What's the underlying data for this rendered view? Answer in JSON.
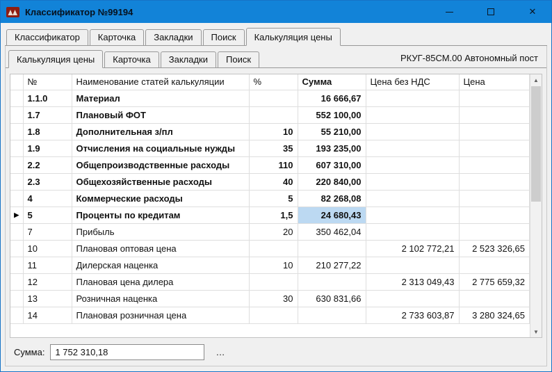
{
  "colors": {
    "titlebar": "#1283d8",
    "selection": "#bcd9f2",
    "window_border": "#1673c6"
  },
  "window": {
    "title": "Классификатор №99194"
  },
  "outer_tabs": [
    {
      "label": "Классификатор"
    },
    {
      "label": "Карточка"
    },
    {
      "label": "Закладки"
    },
    {
      "label": "Поиск"
    },
    {
      "label": "Калькуляция цены"
    }
  ],
  "inner_tabs": [
    {
      "label": "Калькуляция цены"
    },
    {
      "label": "Карточка"
    },
    {
      "label": "Закладки"
    },
    {
      "label": "Поиск"
    }
  ],
  "document_label": "РКУГ-85СМ.00 Автономный пост",
  "table": {
    "columns": [
      "№",
      "Наименование статей калькуляции",
      "%",
      "Сумма",
      "Цена без НДС",
      "Цена"
    ],
    "rows": [
      {
        "num": "1.1.0",
        "name": "Материал",
        "pct": "",
        "sum": "16 666,67",
        "nds": "",
        "price": "",
        "bold": true,
        "selected": false
      },
      {
        "num": "1.7",
        "name": "Плановый ФОТ",
        "pct": "",
        "sum": "552 100,00",
        "nds": "",
        "price": "",
        "bold": true,
        "selected": false
      },
      {
        "num": "1.8",
        "name": "Дополнительная з/пл",
        "pct": "10",
        "sum": "55 210,00",
        "nds": "",
        "price": "",
        "bold": true,
        "selected": false
      },
      {
        "num": "1.9",
        "name": "Отчисления на социальные нужды",
        "pct": "35",
        "sum": "193 235,00",
        "nds": "",
        "price": "",
        "bold": true,
        "selected": false
      },
      {
        "num": "2.2",
        "name": "Общепроизводственные расходы",
        "pct": "110",
        "sum": "607 310,00",
        "nds": "",
        "price": "",
        "bold": true,
        "selected": false
      },
      {
        "num": "2.3",
        "name": "Общехозяйственные расходы",
        "pct": "40",
        "sum": "220 840,00",
        "nds": "",
        "price": "",
        "bold": true,
        "selected": false
      },
      {
        "num": "4",
        "name": "Коммерческие расходы",
        "pct": "5",
        "sum": "82 268,08",
        "nds": "",
        "price": "",
        "bold": true,
        "selected": false
      },
      {
        "num": "5",
        "name": "Проценты по кредитам",
        "pct": "1,5",
        "sum": "24 680,43",
        "nds": "",
        "price": "",
        "bold": true,
        "selected": true
      },
      {
        "num": "7",
        "name": "Прибыль",
        "pct": "20",
        "sum": "350 462,04",
        "nds": "",
        "price": "",
        "bold": false,
        "selected": false
      },
      {
        "num": "10",
        "name": "Плановая оптовая цена",
        "pct": "",
        "sum": "",
        "nds": "2 102 772,21",
        "price": "2 523 326,65",
        "bold": false,
        "selected": false
      },
      {
        "num": "11",
        "name": "Дилерская наценка",
        "pct": "10",
        "sum": "210 277,22",
        "nds": "",
        "price": "",
        "bold": false,
        "selected": false
      },
      {
        "num": "12",
        "name": "Плановая цена дилера",
        "pct": "",
        "sum": "",
        "nds": "2 313 049,43",
        "price": "2 775 659,32",
        "bold": false,
        "selected": false
      },
      {
        "num": "13",
        "name": "Розничная наценка",
        "pct": "30",
        "sum": "630 831,66",
        "nds": "",
        "price": "",
        "bold": false,
        "selected": false
      },
      {
        "num": "14",
        "name": "Плановая розничная цена",
        "pct": "",
        "sum": "",
        "nds": "2 733 603,87",
        "price": "3 280 324,65",
        "bold": false,
        "selected": false
      }
    ],
    "selected_row_marker": "▶"
  },
  "scrollbar": {
    "up_arrow": "▲",
    "down_arrow": "▼"
  },
  "footer": {
    "label": "Сумма:",
    "value": "1 752 310,18",
    "more_button": "…"
  }
}
